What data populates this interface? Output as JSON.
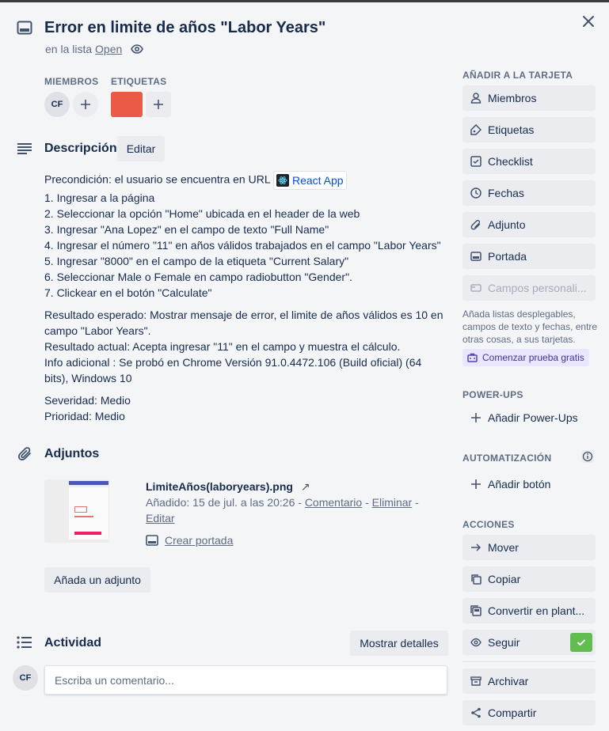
{
  "header": {
    "title": "Error en limite de años \"Labor Years\"",
    "in_list_prefix": "en la lista",
    "list_name": "Open"
  },
  "members": {
    "heading": "MIEMBROS",
    "avatar_initials": "CF"
  },
  "labels": {
    "heading": "ETIQUETAS",
    "label_color": "#eb5a46"
  },
  "description": {
    "title": "Descripción",
    "edit_label": "Editar",
    "precondition_prefix": "Precondición: el usuario se encuentra en URL",
    "link_text": "React App",
    "steps": [
      "1. Ingresar a la página",
      "2. Seleccionar la opción \"Home\" ubicada en el header de la web",
      "3. Ingresar \"Ana Lopez\" en el campo de texto \"Full Name\"",
      "4. Ingresar el número \"11\" en años válidos trabajados en el campo \"Labor Years\"",
      "5. Ingresar \"8000\" en el campo de la etiqueta \"Current Salary\"",
      "6. Seleccionar Male o Female en campo radiobutton \"Gender\".",
      "7. Clickear en el botón \"Calculate\""
    ],
    "expected": "Resultado esperado: Mostrar mensaje de error, el limite de años válidos es 10 en campo \"Labor Years\".",
    "actual": "Resultado actual: Acepta ingresar \"11\" en el campo y muestra el cálculo.",
    "info": "Info adicional : Se probó en Chrome Versión 91.0.4472.106 (Build oficial) (64 bits), Windows 10",
    "severity": "Severidad: Medio",
    "priority": "Prioridad: Medio"
  },
  "attachments": {
    "title": "Adjuntos",
    "file_name": "LimiteAños(laboryears).png",
    "added_text": "Añadido: 15 de jul. a las 20:26 -",
    "comment_link": "Comentario",
    "delete_link": "Eliminar",
    "edit_link": "Editar",
    "make_cover": "Crear portada",
    "add_button": "Añada un adjunto"
  },
  "activity": {
    "title": "Actividad",
    "show_details": "Mostrar detalles",
    "avatar_initials": "CF",
    "comment_placeholder": "Escriba un comentario..."
  },
  "sidebar": {
    "add_to_card": "AÑADIR A LA TARJETA",
    "add_items": [
      {
        "label": "Miembros",
        "icon": "person-icon"
      },
      {
        "label": "Etiquetas",
        "icon": "tag-icon"
      },
      {
        "label": "Checklist",
        "icon": "checklist-icon"
      },
      {
        "label": "Fechas",
        "icon": "clock-icon"
      },
      {
        "label": "Adjunto",
        "icon": "paperclip-icon"
      },
      {
        "label": "Portada",
        "icon": "cover-icon"
      }
    ],
    "custom_fields": "Campos personali...",
    "custom_fields_note": "Añada listas desplegables, campos de texto y fechas, entre otras cosas, a sus tarjetas.",
    "trial_button": "Comenzar prueba gratis",
    "powerups_heading": "POWER-UPS",
    "add_powerups": "Añadir Power-Ups",
    "automation_heading": "AUTOMATIZACIÓN",
    "add_button": "Añadir botón",
    "actions_heading": "ACCIONES",
    "actions": [
      {
        "label": "Mover",
        "icon": "arrow-right-icon"
      },
      {
        "label": "Copiar",
        "icon": "copy-icon"
      },
      {
        "label": "Convertir en plant...",
        "icon": "template-icon"
      },
      {
        "label": "Seguir",
        "icon": "eye-icon"
      }
    ],
    "archive": "Archivar",
    "share": "Compartir"
  },
  "colors": {
    "accent_green": "#61bd4f",
    "label_red": "#eb5a46"
  }
}
